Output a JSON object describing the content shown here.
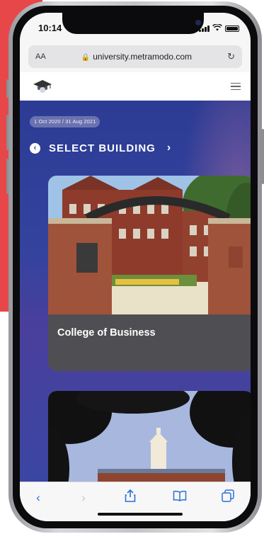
{
  "status_bar": {
    "time": "10:14"
  },
  "browser": {
    "text_size_label": "AA",
    "url": "university.metramodo.com"
  },
  "site": {
    "date_range": "1 Oct 2020 / 31 Aug 2021",
    "section_title": "SELECT BUILDING",
    "buildings": [
      {
        "name": "College of Business"
      }
    ]
  },
  "colors": {
    "accent_red": "#e8474a",
    "content_blue": "#2c3b94",
    "ios_blue": "#2a6fd8"
  },
  "icons": {
    "toolbar": [
      "back-icon",
      "forward-icon",
      "share-icon",
      "bookmarks-icon",
      "tabs-icon"
    ]
  }
}
